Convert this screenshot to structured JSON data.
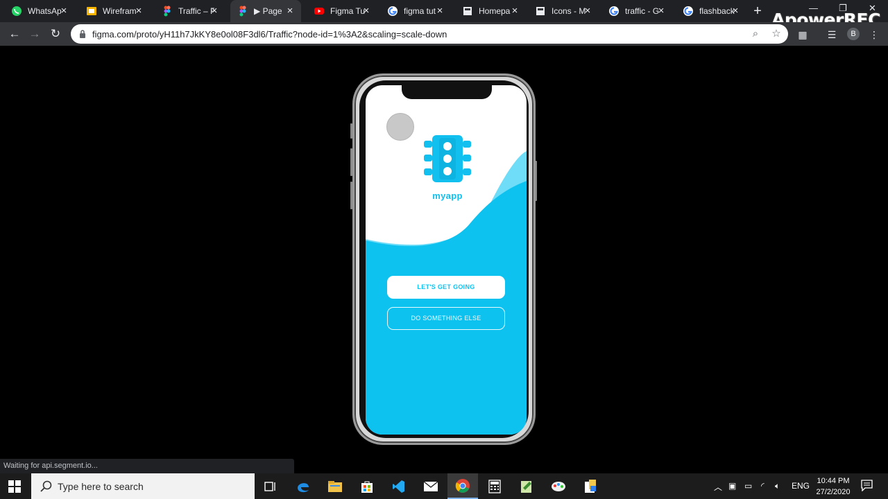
{
  "browser": {
    "tabs": [
      {
        "label": "WhatsAp",
        "icon": "whatsapp-icon"
      },
      {
        "label": "Wirefram",
        "icon": "google-slides-icon"
      },
      {
        "label": "Traffic – F",
        "icon": "figma-icon"
      },
      {
        "label": "▶ Page",
        "icon": "figma-icon",
        "active": true
      },
      {
        "label": "Figma Tu",
        "icon": "youtube-icon"
      },
      {
        "label": "figma tut",
        "icon": "google-icon"
      },
      {
        "label": "Homepa",
        "icon": "page-icon"
      },
      {
        "label": "Icons - M",
        "icon": "page-icon"
      },
      {
        "label": "traffic - G",
        "icon": "google-icon"
      },
      {
        "label": "flashback",
        "icon": "google-icon"
      }
    ],
    "url": "figma.com/proto/yH11h7JkKY8e0ol08F3dl6/Traffic?node-id=1%3A2&scaling=scale-down",
    "profile_initial": "B",
    "status_text": "Waiting for api.segment.io..."
  },
  "watermark": "ApowerREC",
  "prototype": {
    "app_name": "myapp",
    "primary_button": "LET'S GET GOING",
    "secondary_button": "DO SOMETHING ELSE",
    "colors": {
      "brand": "#0ec2f0",
      "wave_light": "#6fdcf8",
      "background": "#ffffff"
    }
  },
  "taskbar": {
    "search_placeholder": "Type here to search",
    "language": "ENG",
    "time": "10:44 PM",
    "date": "27/2/2020"
  }
}
